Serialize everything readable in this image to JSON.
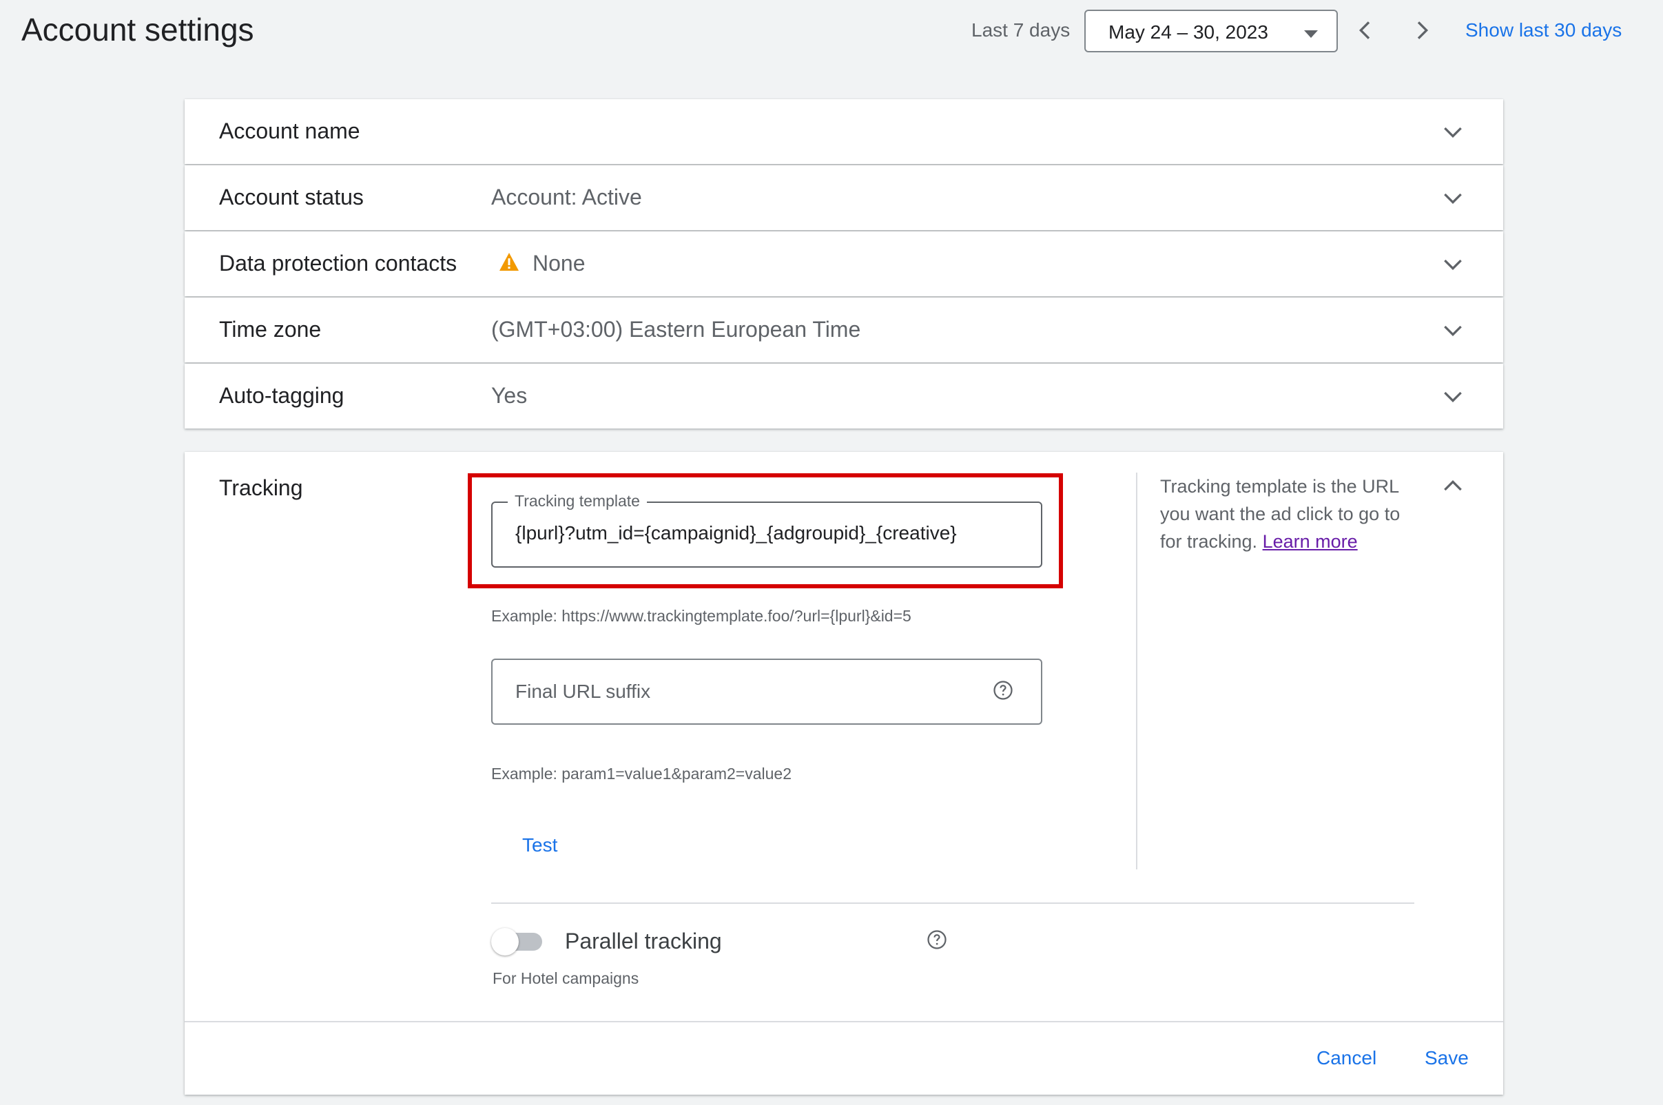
{
  "header": {
    "title": "Account settings",
    "range_label": "Last 7 days",
    "date_range": "May 24 – 30, 2023",
    "show_last_30": "Show last 30 days"
  },
  "rows": [
    {
      "label": "Account name",
      "value": ""
    },
    {
      "label": "Account status",
      "value": "Account: Active"
    },
    {
      "label": "Data protection contacts",
      "value": "None",
      "icon": "warning-icon",
      "icon_color": "#f29900"
    },
    {
      "label": "Time zone",
      "value": "(GMT+03:00) Eastern European Time"
    },
    {
      "label": "Auto-tagging",
      "value": "Yes"
    }
  ],
  "tracking": {
    "title": "Tracking",
    "template_label": "Tracking template",
    "template_value": "{lpurl}?utm_id={campaignid}_{adgroupid}_{creative}",
    "template_example": "Example: https://www.trackingtemplate.foo/?url={lpurl}&id=5",
    "suffix_placeholder": "Final URL suffix",
    "suffix_example": "Example: param1=value1&param2=value2",
    "test_label": "Test",
    "help_text": "Tracking template is the URL you want the ad click to go to for tracking.",
    "learn_more": "Learn more",
    "parallel_label": "Parallel tracking",
    "parallel_sub": "For Hotel campaigns",
    "parallel_enabled": false
  },
  "footer": {
    "cancel": "Cancel",
    "save": "Save"
  },
  "colors": {
    "accent": "#1a73e8",
    "highlight": "#d50000",
    "link_visited": "#681da8"
  }
}
